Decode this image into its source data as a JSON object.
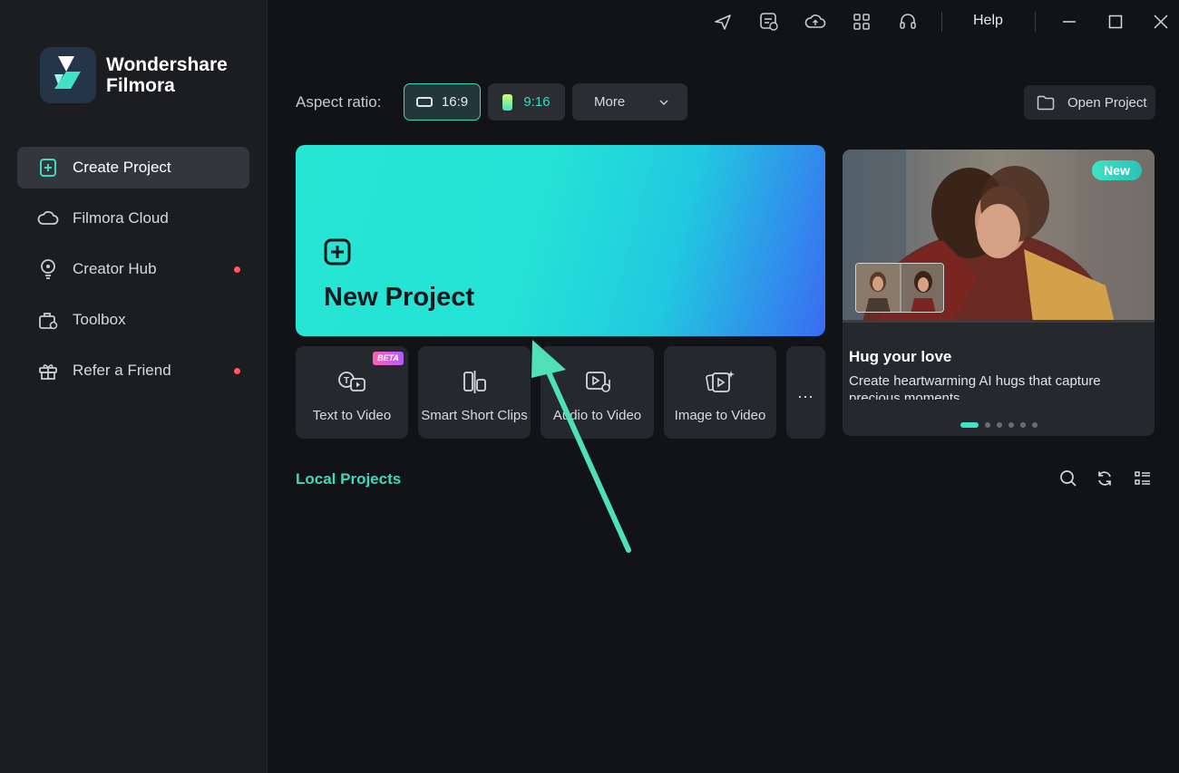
{
  "app": {
    "name_line1": "Wondershare",
    "name_line2": "Filmora"
  },
  "sidebar": {
    "items": [
      {
        "label": "Create Project",
        "icon": "create-project-icon",
        "active": true,
        "dot": false
      },
      {
        "label": "Filmora Cloud",
        "icon": "cloud-icon",
        "active": false,
        "dot": false
      },
      {
        "label": "Creator Hub",
        "icon": "bulb-icon",
        "active": false,
        "dot": true
      },
      {
        "label": "Toolbox",
        "icon": "toolbox-icon",
        "active": false,
        "dot": false
      },
      {
        "label": "Refer a Friend",
        "icon": "gift-icon",
        "active": false,
        "dot": true
      }
    ]
  },
  "titlebar": {
    "icons": [
      "send-icon",
      "feedback-icon",
      "cloud-upload-icon",
      "apps-grid-icon",
      "headset-icon"
    ],
    "help_label": "Help",
    "window_controls": [
      "minimize-icon",
      "maximize-icon",
      "close-icon"
    ]
  },
  "aspect": {
    "label": "Aspect ratio:",
    "options": [
      {
        "label": "16:9",
        "selected": true
      },
      {
        "label": "9:16",
        "selected": false
      }
    ],
    "more_label": "More"
  },
  "open_project_label": "Open Project",
  "new_project": {
    "title": "New Project"
  },
  "tools": [
    {
      "label": "Text to Video",
      "badge": "BETA",
      "icon": "text-to-video-icon"
    },
    {
      "label": "Smart Short Clips",
      "icon": "smart-clips-icon"
    },
    {
      "label": "Audio to Video",
      "icon": "audio-to-video-icon"
    },
    {
      "label": "Image to Video",
      "icon": "image-to-video-icon"
    }
  ],
  "more_tools_label": "...",
  "promo": {
    "badge": "New",
    "title": "Hug your love",
    "description": "Create heartwarming AI hugs that capture precious moments.",
    "slides": 6,
    "active_slide": 0
  },
  "local_projects": {
    "title": "Local Projects",
    "icons": [
      "search-icon",
      "refresh-icon",
      "list-view-icon"
    ]
  },
  "colors": {
    "accent": "#3fd8c0",
    "sidebar_bg": "#1b1d21",
    "main_bg": "#111316",
    "notification_dot": "#ff5a5a",
    "annotation_arrow": "#4fe0b8"
  }
}
